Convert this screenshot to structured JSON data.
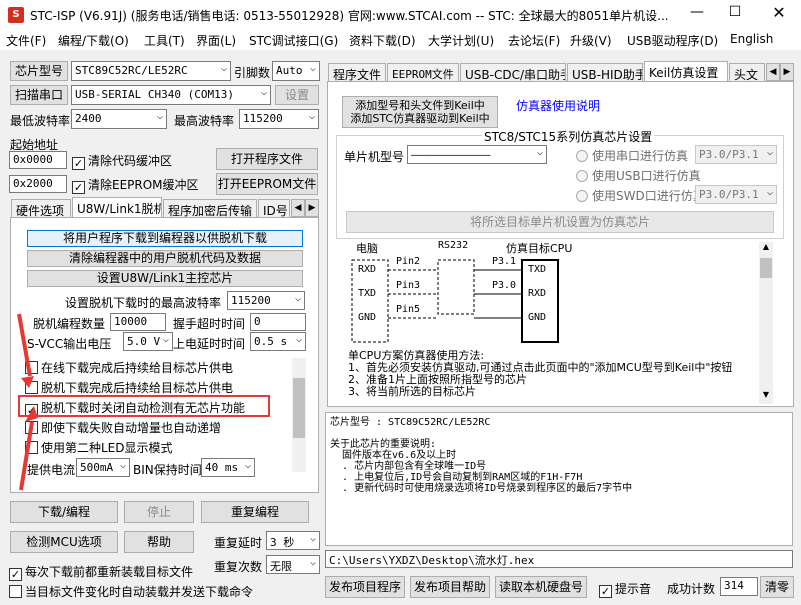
{
  "window": {
    "title": "STC-ISP (V6.91J) (服务电话/销售电话: 0513-55012928) 官网:www.STCAI.com  -- STC: 全球最大的8051单片机设..."
  },
  "menu": [
    "文件(F)",
    "编程/下载(O)",
    "工具(T)",
    "界面(L)",
    "STC调试接口(G)",
    "资料下载(D)",
    "大学计划(U)",
    "去论坛(F)",
    "升级(V)",
    "USB驱动程序(D)",
    "English"
  ],
  "left": {
    "chip_label": "芯片型号",
    "chip_value": "STC89C52RC/LE52RC",
    "pins_label": "引脚数",
    "pins_value": "Auto",
    "scan_button": "扫描串口",
    "port_value": "USB-SERIAL CH340 (COM13)",
    "settings_button": "设置",
    "min_baud_label": "最低波特率",
    "min_baud_value": "2400",
    "max_baud_label": "最高波特率",
    "max_baud_value": "115200",
    "start_addr_label": "起始地址",
    "addr1": "0x0000",
    "clear_code_label": "清除代码缓冲区",
    "open_prog_button": "打开程序文件",
    "addr2": "0x2000",
    "clear_eeprom_label": "清除EEPROM缓冲区",
    "open_eeprom_button": "打开EEPROM文件",
    "tabs": [
      "硬件选项",
      "U8W/Link1脱机",
      "程序加密后传输",
      "ID号"
    ],
    "offline": {
      "btn1": "将用户程序下载到编程器以供脱机下载",
      "btn2": "清除编程器中的用户脱机代码及数据",
      "btn3": "设置U8W/Link1主控芯片",
      "max_baud_label": "设置脱机下载时的最高波特率",
      "max_baud_value": "115200",
      "count_label": "脱机编程数量",
      "count_value": "10000",
      "handshake_label": "握手超时时间",
      "handshake_value": "0",
      "svcc_label": "S-VCC输出电压",
      "svcc_value": "5.0 V",
      "delay_label": "上电延时时间",
      "delay_value": "0.5 s",
      "chk1": "在线下载完成后持续给目标芯片供电",
      "chk2": "脱机下载完成后持续给目标芯片供电",
      "chk3": "脱机下载时关闭自动检测有无芯片功能",
      "chk4": "即使下载失败自动增量也自动递增",
      "chk5": "使用第二种LED显示模式",
      "current_label": "提供电流",
      "current_value": "500mA",
      "bin_label": "BIN保持时间",
      "bin_value": "40 ms"
    },
    "download_button": "下载/编程",
    "stop_button": "停止",
    "reprog_button": "重复编程",
    "check_mcu_button": "检测MCU选项",
    "help_button": "帮助",
    "repeat_delay_label": "重复延时",
    "repeat_delay_value": "3 秒",
    "repeat_count_label": "重复次数",
    "repeat_count_value": "无限",
    "reload_label": "每次下载前都重新装载目标文件",
    "auto_load_label": "当目标文件变化时自动装载并发送下载命令"
  },
  "right": {
    "tabs": [
      "程序文件",
      "EEPROM文件",
      "USB-CDC/串口助手",
      "USB-HID助手",
      "Keil仿真设置",
      "头文"
    ],
    "add_keil_button_line1": "添加型号和头文件到Keil中",
    "add_keil_button_line2": "添加STC仿真器驱动到Keil中",
    "emu_link": "仿真器使用说明",
    "group_title": "STC8/STC15系列仿真芯片设置",
    "mcu_label": "单片机型号",
    "mcu_value": "————————————",
    "radio1": "使用串口进行仿真",
    "radio1_value": "P3.0/P3.1",
    "radio2": "使用USB口进行仿真",
    "radio3": "使用SWD口进行仿真",
    "radio3_value": "P3.0/P3.1",
    "set_target_button": "将所选目标单片机设置为仿真芯片",
    "diagram": {
      "pc": "电脑",
      "rs232": "RS232",
      "target": "仿真目标CPU",
      "rxd": "RXD",
      "txd": "TXD",
      "gnd": "GND",
      "pin2": "Pin2",
      "pin3": "Pin3",
      "pin5": "Pin5",
      "p31": "P3.1",
      "p30": "P3.0"
    },
    "notes": [
      "单CPU方案仿真器使用方法:",
      "1、首先必须安装仿真驱动,可通过点击此页面中的\"添加MCU型号到Keil中\"按钮",
      "2、准备1片上面按照所指型号的芯片",
      "3、将当前所选的目标芯片"
    ],
    "info_lines": [
      "芯片型号 : STC89C52RC/LE52RC",
      "",
      "关于此芯片的重要说明:",
      "  固件版本在v6.6及以上时",
      "  . 芯片内部包含有全球唯一ID号",
      "  . 上电复位后,ID号会自动复制到RAM区域的F1H-F7H",
      "  . 更新代码时可使用烧录选项将ID号烧录到程序区的最后7字节中"
    ],
    "filepath": "C:\\Users\\YXDZ\\Desktop\\流水灯.hex",
    "publish_button": "发布项目程序",
    "publish_help_button": "发布项目帮助",
    "read_disk_button": "读取本机硬盘号",
    "sound_label": "提示音",
    "success_label": "成功计数",
    "success_value": "314",
    "clear_button": "清零"
  },
  "colors": {
    "highlight": "#e53935",
    "link": "#0000ff",
    "selected_border": "#0078d7"
  }
}
